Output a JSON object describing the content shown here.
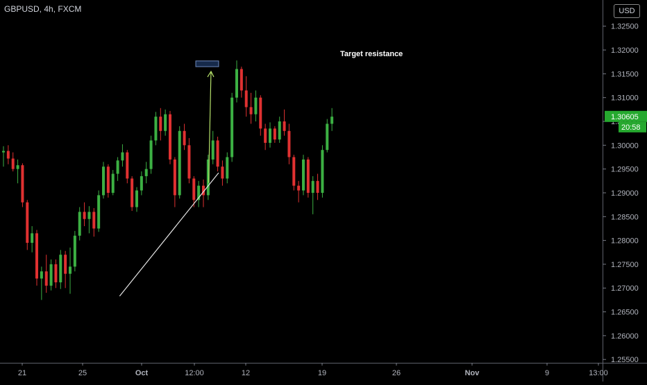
{
  "header": {
    "title": "GBPUSD, 4h, FXCM",
    "currency_badge": "USD"
  },
  "colors": {
    "up": "#3cb043",
    "down": "#e03131",
    "trend": "#e6e6e6",
    "arrow": "#b7e36b",
    "zone_fill": "#162a4a",
    "zone_border": "#6e89bd"
  },
  "price_tag": {
    "price": "1.30605",
    "countdown": "20:58",
    "color": "#26a92f"
  },
  "chart_data": {
    "type": "candlestick",
    "title": "GBPUSD, 4h, FXCM",
    "y_ticks": [
      1.325,
      1.32,
      1.315,
      1.31,
      1.305,
      1.3,
      1.295,
      1.29,
      1.285,
      1.28,
      1.275,
      1.27,
      1.265,
      1.26,
      1.255
    ],
    "y_tick_labels": [
      "1.32500",
      "1.32000",
      "1.31500",
      "1.31000",
      "1.30500",
      "1.30000",
      "1.29500",
      "1.29000",
      "1.28500",
      "1.28000",
      "1.27500",
      "1.27000",
      "1.26500",
      "1.26000",
      "1.25500"
    ],
    "ylim": [
      1.2543,
      1.3305
    ],
    "x_tick_labels": [
      "21",
      "25",
      "Oct",
      "12:00",
      "12",
      "19",
      "26",
      "Nov",
      "9",
      "13:00"
    ],
    "x_tick_bold": [
      false,
      false,
      true,
      false,
      false,
      false,
      false,
      true,
      false,
      false
    ],
    "trendline": {
      "start": [
        24.4,
        1.2683
      ],
      "end": [
        45.2,
        1.2942
      ]
    },
    "resistance_zone": {
      "label": "Target resistance",
      "x_start": 40.4,
      "x_end": 45.2,
      "y_low": 1.3165,
      "y_high": 1.3177
    },
    "projection_arrow": {
      "start": [
        43.1,
        1.2921
      ],
      "end": [
        43.6,
        1.3155
      ]
    },
    "last_price": 1.30605,
    "candles": [
      {
        "o": 1.2985,
        "h": 1.2998,
        "l": 1.2955,
        "c": 1.2988
      },
      {
        "o": 1.2988,
        "h": 1.3,
        "l": 1.296,
        "c": 1.2972
      },
      {
        "o": 1.2972,
        "h": 1.2985,
        "l": 1.2945,
        "c": 1.295
      },
      {
        "o": 1.295,
        "h": 1.297,
        "l": 1.292,
        "c": 1.2958
      },
      {
        "o": 1.2958,
        "h": 1.2962,
        "l": 1.287,
        "c": 1.288
      },
      {
        "o": 1.288,
        "h": 1.2885,
        "l": 1.278,
        "c": 1.2795
      },
      {
        "o": 1.2795,
        "h": 1.283,
        "l": 1.2775,
        "c": 1.2815
      },
      {
        "o": 1.2815,
        "h": 1.2822,
        "l": 1.2705,
        "c": 1.272
      },
      {
        "o": 1.272,
        "h": 1.2745,
        "l": 1.2675,
        "c": 1.2735
      },
      {
        "o": 1.2735,
        "h": 1.277,
        "l": 1.269,
        "c": 1.2705
      },
      {
        "o": 1.2705,
        "h": 1.276,
        "l": 1.2695,
        "c": 1.275
      },
      {
        "o": 1.275,
        "h": 1.276,
        "l": 1.27,
        "c": 1.2712
      },
      {
        "o": 1.2712,
        "h": 1.278,
        "l": 1.2698,
        "c": 1.277
      },
      {
        "o": 1.277,
        "h": 1.2778,
        "l": 1.27,
        "c": 1.273
      },
      {
        "o": 1.273,
        "h": 1.2785,
        "l": 1.2688,
        "c": 1.2745
      },
      {
        "o": 1.2745,
        "h": 1.282,
        "l": 1.2735,
        "c": 1.281
      },
      {
        "o": 1.281,
        "h": 1.287,
        "l": 1.28,
        "c": 1.286
      },
      {
        "o": 1.286,
        "h": 1.288,
        "l": 1.283,
        "c": 1.2845
      },
      {
        "o": 1.2845,
        "h": 1.2872,
        "l": 1.2815,
        "c": 1.286
      },
      {
        "o": 1.286,
        "h": 1.2868,
        "l": 1.2808,
        "c": 1.2825
      },
      {
        "o": 1.2825,
        "h": 1.2905,
        "l": 1.2818,
        "c": 1.2895
      },
      {
        "o": 1.2895,
        "h": 1.2965,
        "l": 1.2888,
        "c": 1.2955
      },
      {
        "o": 1.2955,
        "h": 1.296,
        "l": 1.289,
        "c": 1.29
      },
      {
        "o": 1.29,
        "h": 1.2948,
        "l": 1.2895,
        "c": 1.294
      },
      {
        "o": 1.294,
        "h": 1.2975,
        "l": 1.2925,
        "c": 1.2968
      },
      {
        "o": 1.2968,
        "h": 1.3002,
        "l": 1.2955,
        "c": 1.2985
      },
      {
        "o": 1.2985,
        "h": 1.299,
        "l": 1.292,
        "c": 1.293
      },
      {
        "o": 1.293,
        "h": 1.2935,
        "l": 1.2862,
        "c": 1.287
      },
      {
        "o": 1.287,
        "h": 1.2912,
        "l": 1.286,
        "c": 1.2905
      },
      {
        "o": 1.2905,
        "h": 1.2945,
        "l": 1.2895,
        "c": 1.2935
      },
      {
        "o": 1.2935,
        "h": 1.2965,
        "l": 1.292,
        "c": 1.295
      },
      {
        "o": 1.295,
        "h": 1.302,
        "l": 1.294,
        "c": 1.301
      },
      {
        "o": 1.301,
        "h": 1.307,
        "l": 1.3,
        "c": 1.306
      },
      {
        "o": 1.306,
        "h": 1.3078,
        "l": 1.301,
        "c": 1.303
      },
      {
        "o": 1.303,
        "h": 1.3075,
        "l": 1.302,
        "c": 1.3065
      },
      {
        "o": 1.3065,
        "h": 1.3072,
        "l": 1.296,
        "c": 1.297
      },
      {
        "o": 1.297,
        "h": 1.2975,
        "l": 1.287,
        "c": 1.2895
      },
      {
        "o": 1.2895,
        "h": 1.304,
        "l": 1.2888,
        "c": 1.303
      },
      {
        "o": 1.303,
        "h": 1.3045,
        "l": 1.299,
        "c": 1.3
      },
      {
        "o": 1.3,
        "h": 1.3015,
        "l": 1.292,
        "c": 1.293
      },
      {
        "o": 1.293,
        "h": 1.2935,
        "l": 1.287,
        "c": 1.2885
      },
      {
        "o": 1.2885,
        "h": 1.2925,
        "l": 1.287,
        "c": 1.2915
      },
      {
        "o": 1.2915,
        "h": 1.2928,
        "l": 1.287,
        "c": 1.2895
      },
      {
        "o": 1.2895,
        "h": 1.298,
        "l": 1.2885,
        "c": 1.297
      },
      {
        "o": 1.297,
        "h": 1.303,
        "l": 1.296,
        "c": 1.301
      },
      {
        "o": 1.301,
        "h": 1.3018,
        "l": 1.2945,
        "c": 1.2955
      },
      {
        "o": 1.2955,
        "h": 1.2968,
        "l": 1.2915,
        "c": 1.293
      },
      {
        "o": 1.293,
        "h": 1.2985,
        "l": 1.292,
        "c": 1.2975
      },
      {
        "o": 1.2975,
        "h": 1.311,
        "l": 1.2965,
        "c": 1.31
      },
      {
        "o": 1.31,
        "h": 1.3178,
        "l": 1.309,
        "c": 1.316
      },
      {
        "o": 1.316,
        "h": 1.3165,
        "l": 1.31,
        "c": 1.3115
      },
      {
        "o": 1.3115,
        "h": 1.3145,
        "l": 1.306,
        "c": 1.308
      },
      {
        "o": 1.308,
        "h": 1.311,
        "l": 1.3045,
        "c": 1.3065
      },
      {
        "o": 1.3065,
        "h": 1.3115,
        "l": 1.305,
        "c": 1.31
      },
      {
        "o": 1.31,
        "h": 1.3105,
        "l": 1.302,
        "c": 1.3035
      },
      {
        "o": 1.3035,
        "h": 1.3045,
        "l": 1.299,
        "c": 1.3005
      },
      {
        "o": 1.3005,
        "h": 1.3048,
        "l": 1.2995,
        "c": 1.3035
      },
      {
        "o": 1.3035,
        "h": 1.304,
        "l": 1.3005,
        "c": 1.3012
      },
      {
        "o": 1.3012,
        "h": 1.306,
        "l": 1.3005,
        "c": 1.305
      },
      {
        "o": 1.305,
        "h": 1.3075,
        "l": 1.302,
        "c": 1.303
      },
      {
        "o": 1.303,
        "h": 1.3045,
        "l": 1.296,
        "c": 1.2975
      },
      {
        "o": 1.2975,
        "h": 1.298,
        "l": 1.2905,
        "c": 1.2915
      },
      {
        "o": 1.2915,
        "h": 1.2925,
        "l": 1.288,
        "c": 1.2905
      },
      {
        "o": 1.2905,
        "h": 1.298,
        "l": 1.2895,
        "c": 1.297
      },
      {
        "o": 1.297,
        "h": 1.2975,
        "l": 1.289,
        "c": 1.29
      },
      {
        "o": 1.29,
        "h": 1.2935,
        "l": 1.2855,
        "c": 1.2925
      },
      {
        "o": 1.2925,
        "h": 1.294,
        "l": 1.2885,
        "c": 1.29
      },
      {
        "o": 1.29,
        "h": 1.3,
        "l": 1.289,
        "c": 1.299
      },
      {
        "o": 1.299,
        "h": 1.3055,
        "l": 1.2985,
        "c": 1.3045
      },
      {
        "o": 1.3045,
        "h": 1.3078,
        "l": 1.303,
        "c": 1.306
      }
    ]
  }
}
